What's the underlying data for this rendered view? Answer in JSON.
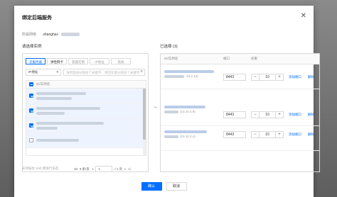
{
  "modal": {
    "title": "绑定后端服务",
    "close_glyph": "✕"
  },
  "region": {
    "label": "所属网络",
    "value": "shanghai-"
  },
  "left": {
    "section_label": "请选择实例",
    "tabs": [
      "云服务器",
      "弹性网卡",
      "容器实例",
      "IP地址",
      "其他"
    ],
    "filter_select": "IP地址",
    "search_placeholder": "请用竖线分隔多个关键字，用回车键分隔多个关键字",
    "list_header": "ID/实例名",
    "pager": {
      "page_size": "10",
      "page_size_suffix": "▾ 条/页",
      "prev": "◂",
      "page": "1",
      "total": "/ 1 页",
      "next": "▸",
      "last": "▸|"
    },
    "hint": "支持按住 shift 键进行多选"
  },
  "transfer_arrows": "↔",
  "right": {
    "section_label": "已选择 (3)",
    "headers": {
      "id": "ID/实例名",
      "port": "端口",
      "weight": "权重"
    },
    "rows": [
      {
        "suffix": ".10.2.10)",
        "port": "8443",
        "weight": "10",
        "add": "添加端口",
        "del": "删除"
      },
      {
        "suffix": "(10.10.2.9)",
        "port": "8443",
        "weight": "10",
        "add": "添加端口",
        "del": "删除"
      },
      {
        "suffix": "(10.10.2.4)",
        "port": "8443",
        "weight": "10",
        "add": "添加端口",
        "del": "删除"
      }
    ],
    "stepper": {
      "minus": "−",
      "plus": "+"
    }
  },
  "footer": {
    "confirm": "确认",
    "cancel": "取消"
  },
  "colors": {
    "primary": "#006eff",
    "border": "#d9d9d9"
  }
}
